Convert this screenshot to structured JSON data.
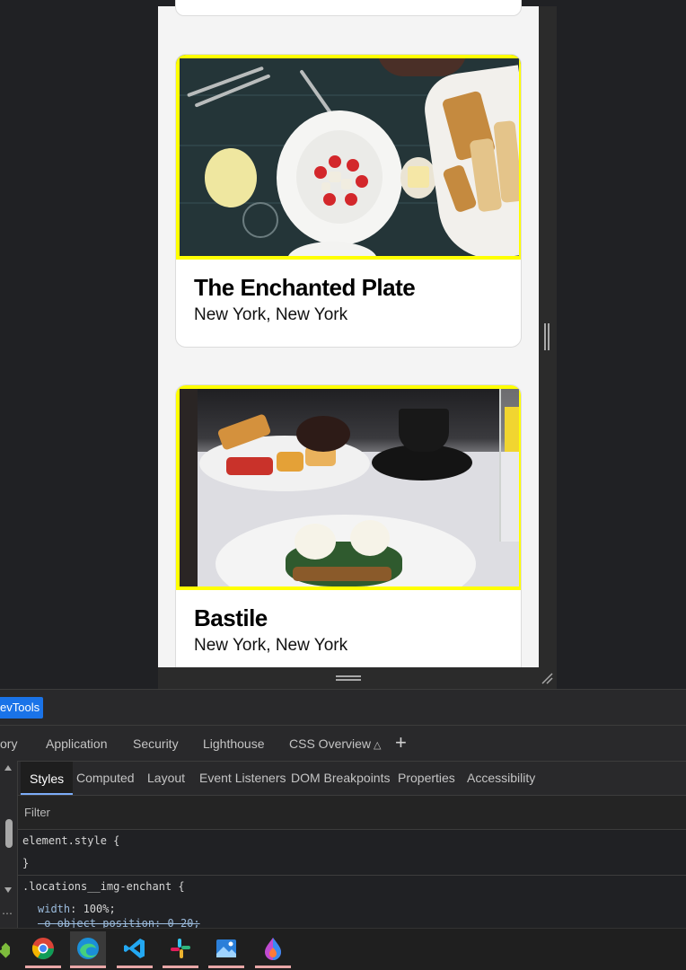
{
  "cards": [
    {
      "title": "The Enchanted Plate",
      "location": "New York, New York"
    },
    {
      "title": "Bastile",
      "location": "New York, New York"
    }
  ],
  "devtools": {
    "chip_label": "evTools",
    "main_tabs": [
      "ory",
      "Application",
      "Security",
      "Lighthouse",
      "CSS Overview"
    ],
    "sub_tabs": [
      "Styles",
      "Computed",
      "Layout",
      "Event Listeners",
      "DOM Breakpoints",
      "Properties",
      "Accessibility"
    ],
    "filter_placeholder": "Filter",
    "styles": {
      "element_style_open": "element.style {",
      "element_style_close": "}",
      "rule_selector": ".locations__img-enchant {",
      "prop1": "width",
      "val1": "100%;",
      "prop2_struck": "-o-object-position: 0 20;"
    }
  },
  "taskbar": {
    "apps": [
      "git-icon",
      "chrome-icon",
      "edge-icon",
      "vscode-icon",
      "slack-icon",
      "photos-icon",
      "paint-drop-icon"
    ]
  },
  "colors": {
    "highlight_border": "#ffff00",
    "devtools_bg": "#29292b",
    "accent_blue": "#1a73e8"
  }
}
